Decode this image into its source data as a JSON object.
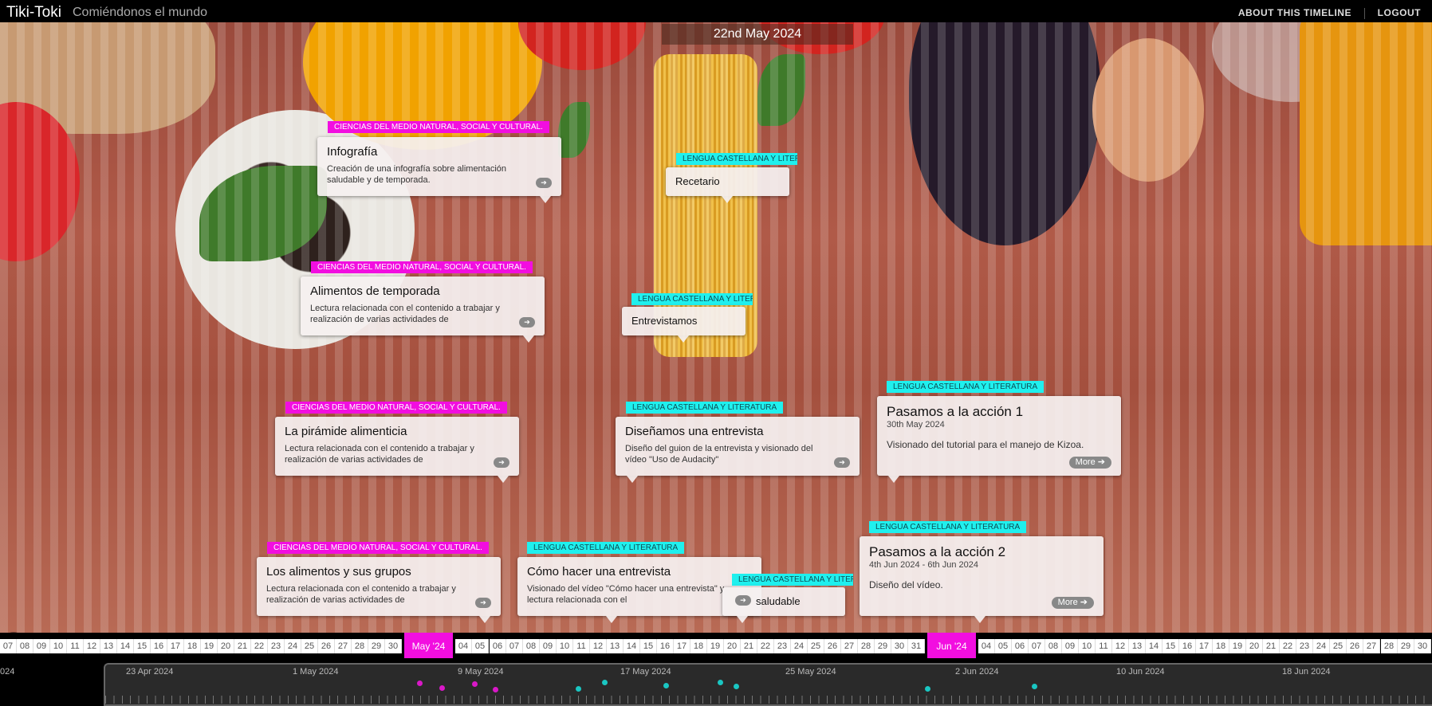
{
  "header": {
    "brand": "Tiki-Toki",
    "timeline_title": "Comiéndonos el mundo",
    "about_link": "ABOUT THIS TIMELINE",
    "logout_link": "LOGOUT"
  },
  "current_date": "22nd May 2024",
  "view_mode_button": "3d",
  "categories": {
    "ciencias": "CIENCIAS DEL MEDIO NATURAL, SOCIAL Y CULTURAL.",
    "lengua": "LENGUA CASTELLANA Y LITERATURA"
  },
  "colors": {
    "ciencias_tag": "#f20ee0",
    "lengua_tag": "#1ff0ee",
    "month_marker": "#f20ee0"
  },
  "events": [
    {
      "title": "Infografía",
      "category": "CIENCIAS DEL MEDIO NATURAL, SOCIAL Y CULTURAL.",
      "text": "Creación de una infografía sobre alimentación saludable y de temporada.",
      "button_icon": "arrow-right-icon"
    },
    {
      "title": "Recetario",
      "category": "LENGUA CASTELLANA Y LITERATURA",
      "text": "",
      "button_icon": ""
    },
    {
      "title": "Alimentos de temporada",
      "category": "CIENCIAS DEL MEDIO NATURAL, SOCIAL Y CULTURAL.",
      "text": "Lectura relacionada con el contenido a trabajar y realización de varias actividades de",
      "button_icon": "arrow-right-icon"
    },
    {
      "title": "Entrevistamos",
      "category": "LENGUA CASTELLANA Y LITERATURA",
      "text": "",
      "button_icon": ""
    },
    {
      "title": "La pirámide alimenticia",
      "category": "CIENCIAS DEL MEDIO NATURAL, SOCIAL Y CULTURAL.",
      "text": "Lectura relacionada con el contenido a trabajar y realización de varias actividades de",
      "button_icon": "arrow-right-icon"
    },
    {
      "title": "Diseñamos una entrevista",
      "category": "LENGUA CASTELLANA Y LITERATURA",
      "text": "Diseño del guion de la entrevista y visionado del vídeo \"Uso de Audacity\"",
      "button_icon": "arrow-right-icon"
    },
    {
      "title": "Pasamos a la acción 1",
      "category": "LENGUA CASTELLANA Y LITERATURA",
      "date": "30th May 2024",
      "text": "Visionado del tutorial para el manejo de Kizoa.",
      "button_label": "More"
    },
    {
      "title": "Los alimentos y sus grupos",
      "category": "CIENCIAS DEL MEDIO NATURAL, SOCIAL Y CULTURAL.",
      "text": "Lectura relacionada con el contenido a trabajar y realización de varias actividades de",
      "button_icon": "arrow-right-icon"
    },
    {
      "title": "Cómo hacer una entrevista",
      "category": "LENGUA CASTELLANA Y LITERATURA",
      "text": "Visionado del vídeo \"Cómo hacer una entrevista\" y lectura relacionada con el",
      "button_icon": "arrow-right-icon"
    },
    {
      "title": "saludable",
      "category": "LENGUA CASTELLANA Y LITERATURA",
      "text": "",
      "button_icon": ""
    },
    {
      "title": "Pasamos a la acción 2",
      "category": "LENGUA CASTELLANA Y LITERATURA",
      "date": "4th Jun 2024 - 6th Jun 2024",
      "text": "Diseño del vídeo.",
      "button_label": "More"
    }
  ],
  "day_strip": {
    "days": [
      "07",
      "08",
      "09",
      "10",
      "11",
      "12",
      "13",
      "14",
      "15",
      "16",
      "17",
      "18",
      "19",
      "20",
      "21",
      "22",
      "23",
      "24",
      "25",
      "26",
      "27",
      "28",
      "29",
      "30",
      "04",
      "05",
      "06",
      "07",
      "08",
      "09",
      "10",
      "11",
      "12",
      "13",
      "14",
      "15",
      "16",
      "17",
      "18",
      "19",
      "20",
      "21",
      "22",
      "23",
      "24",
      "25",
      "26",
      "27",
      "28",
      "29",
      "30",
      "31",
      "04",
      "05",
      "06",
      "07",
      "08",
      "09",
      "10",
      "11",
      "12",
      "13",
      "14",
      "15",
      "16",
      "17",
      "18",
      "19",
      "20",
      "21",
      "22",
      "23",
      "24",
      "25",
      "26",
      "27",
      "28",
      "29",
      "30"
    ],
    "months": [
      "May '24",
      "Jun '24"
    ]
  },
  "navigation": {
    "labels": [
      "024",
      "23 Apr 2024",
      "1 May 2024",
      "9 May 2024",
      "17 May 2024",
      "25 May 2024",
      "2 Jun 2024",
      "10 Jun 2024",
      "18 Jun 2024"
    ]
  }
}
